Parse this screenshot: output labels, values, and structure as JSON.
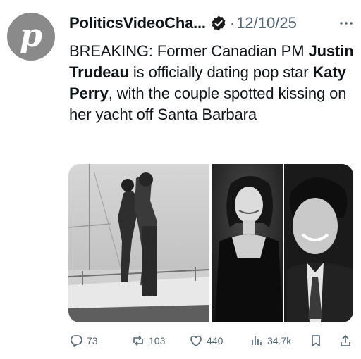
{
  "tweet": {
    "avatar_letter": "p",
    "author_name": "PoliticsVideoCha...",
    "separator": "·",
    "date": "12/10/25",
    "text_parts": {
      "p1": "BREAKING: Former Canadian PM ",
      "b1": "Justin Trudeau",
      "p2": " is officially dating pop star ",
      "b2": "Katy Perry",
      "p3": ", with the couple spotted kissing on her yacht off Santa Barbara"
    }
  },
  "actions": {
    "replies": "73",
    "reposts": "103",
    "likes": "440",
    "views": "34.7k"
  },
  "icons": {
    "verified": "verified-badge-icon",
    "more": "more-options-icon",
    "reply": "reply-icon",
    "repost": "repost-icon",
    "like": "like-heart-icon",
    "views": "views-chart-icon",
    "bookmark": "bookmark-icon",
    "share": "share-icon"
  }
}
